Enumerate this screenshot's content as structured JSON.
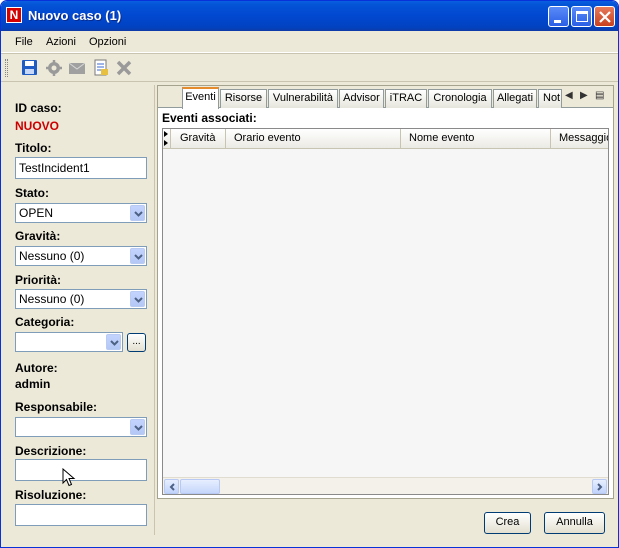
{
  "window": {
    "title": "Nuovo caso (1)",
    "app_icon_letter": "N"
  },
  "menu": [
    "File",
    "Azioni",
    "Opzioni"
  ],
  "toolbar": {
    "icons": [
      "save-icon",
      "settings-icon",
      "mail-icon",
      "report-icon",
      "delete-icon"
    ]
  },
  "case": {
    "id_label": "ID caso:",
    "id_value": "NUOVO",
    "title_label": "Titolo:",
    "title_value": "TestIncident1",
    "state_label": "Stato:",
    "state_value": "OPEN",
    "severity_label": "Gravità:",
    "severity_value": "Nessuno (0)",
    "priority_label": "Priorità:",
    "priority_value": "Nessuno (0)",
    "category_label": "Categoria:",
    "category_value": "",
    "category_button": "...",
    "author_label": "Autore:",
    "author_value": "admin",
    "owner_label": "Responsabile:",
    "owner_value": "",
    "description_label": "Descrizione:",
    "description_value": "",
    "resolution_label": "Risoluzione:",
    "resolution_value": ""
  },
  "tabs": [
    "Eventi",
    "Risorse",
    "Vulnerabilità",
    "Advisor",
    "iTRAC",
    "Cronologia",
    "Allegati",
    "Not"
  ],
  "active_tab": "Eventi",
  "events": {
    "section_title": "Eventi associati:",
    "columns": [
      "Gravità",
      "Orario evento",
      "Nome evento",
      "Messaggio"
    ],
    "rows": []
  },
  "buttons": {
    "create": "Crea",
    "cancel": "Annulla"
  },
  "colors": {
    "titlebar": "#0148d0",
    "case_id": "#cc0000",
    "active_tab_accent": "#e68b2c"
  }
}
